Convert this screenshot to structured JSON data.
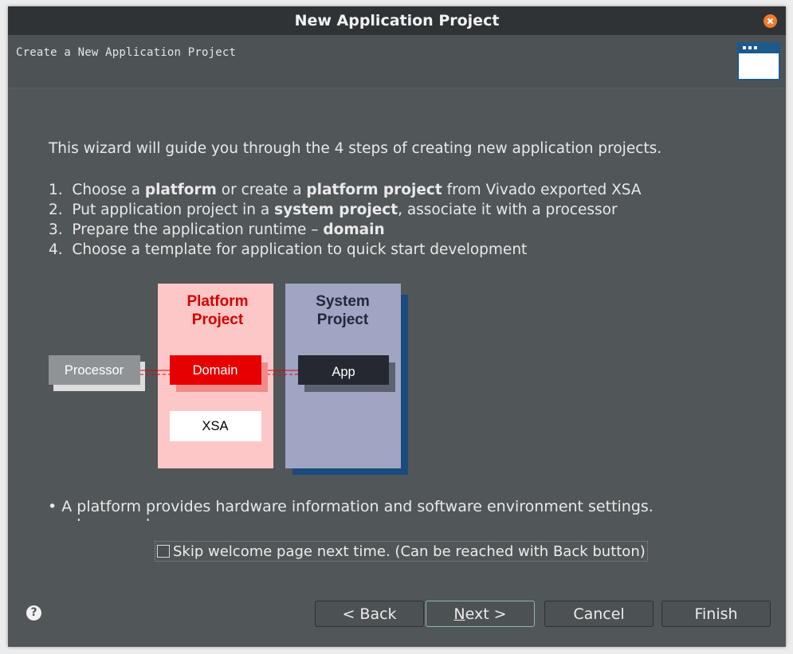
{
  "window": {
    "title": "New Application Project",
    "close_icon": "close-icon"
  },
  "header": {
    "subtitle": "Create a New Application Project",
    "icon": "wizard-window-icon"
  },
  "content": {
    "intro": "This wizard will guide you through the 4 steps of creating new application projects.",
    "steps": [
      {
        "num": "1.",
        "pre": "Choose a ",
        "b1": "platform",
        "mid": " or create a ",
        "b2": "platform project",
        "post": " from Vivado exported XSA"
      },
      {
        "num": "2.",
        "pre": "Put application project in a ",
        "b1": "system project",
        "post": ", associate it with a processor"
      },
      {
        "num": "3.",
        "pre": "Prepare the application runtime – ",
        "b1": "domain"
      },
      {
        "num": "4.",
        "pre": "Choose a template for application to quick start development"
      }
    ],
    "note": "• A platform provides hardware information and software environment settings."
  },
  "diagram": {
    "platform_title_1": "Platform",
    "platform_title_2": "Project",
    "system_title_1": "System",
    "system_title_2": "Project",
    "processor": "Processor",
    "domain": "Domain",
    "xsa": "XSA",
    "app": "App",
    "colors": {
      "platform_bg": "#fec7c7",
      "platform_title": "#d40000",
      "domain": "#e60000",
      "system_bg": "#9fa5c3",
      "system_title": "#222838",
      "app": "#252830",
      "processor": "#8f9396"
    }
  },
  "skip": {
    "checked": false,
    "label": "Skip welcome page next time. (Can be reached with Back button)"
  },
  "footer": {
    "help_icon": "help-icon",
    "back": "< Back",
    "next_u": "N",
    "next_rest": "ext >",
    "cancel": "Cancel",
    "finish": "Finish"
  }
}
